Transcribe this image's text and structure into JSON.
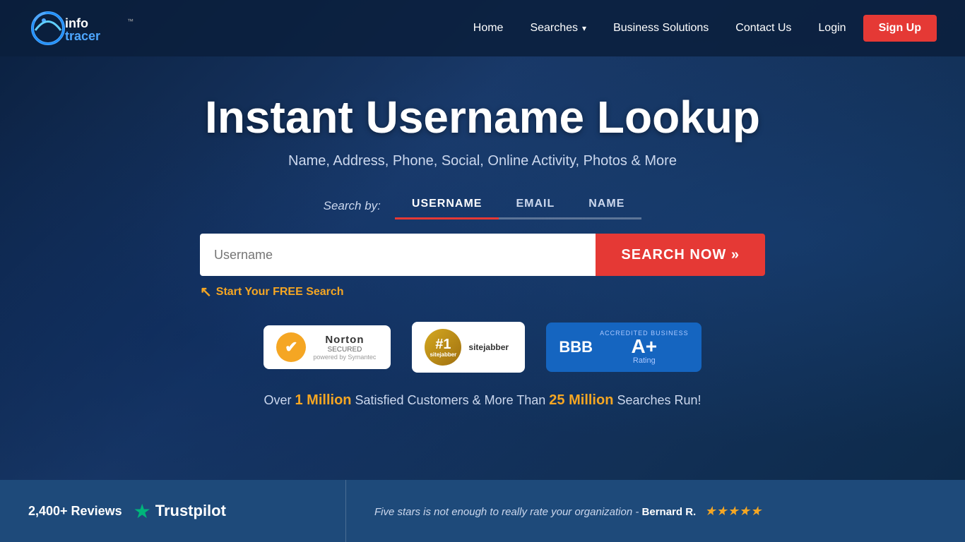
{
  "navbar": {
    "logo_text": "info tracer",
    "links": [
      {
        "id": "home",
        "label": "Home"
      },
      {
        "id": "searches",
        "label": "Searches",
        "has_dropdown": true
      },
      {
        "id": "business",
        "label": "Business Solutions"
      },
      {
        "id": "contact",
        "label": "Contact Us"
      },
      {
        "id": "login",
        "label": "Login"
      }
    ],
    "signup_label": "Sign Up"
  },
  "hero": {
    "title": "Instant Username Lookup",
    "subtitle": "Name, Address, Phone, Social, Online Activity, Photos & More",
    "search_tabs": [
      {
        "id": "username",
        "label": "USERNAME",
        "active": true
      },
      {
        "id": "email",
        "label": "EMAIL",
        "active": false
      },
      {
        "id": "name",
        "label": "NAME",
        "active": false
      }
    ],
    "search_by_label": "Search by:",
    "search_placeholder": "Username",
    "search_button_label": "SEARCH NOW »",
    "free_search_text": "Start Your FREE Search",
    "badges": {
      "norton": {
        "check": "✔",
        "main": "Norton",
        "secured": "SECURED",
        "symantec": "powered by Symantec"
      },
      "sitejabber": {
        "number": "#1",
        "brand": "sitejabber",
        "sub": ""
      },
      "bbb": {
        "logo": "BBB",
        "accredited": "ACCREDITED BUSINESS",
        "rating": "A+",
        "rating_label": "Rating"
      }
    },
    "stats_pre": "Over ",
    "stats_1m": "1 Million",
    "stats_mid": " Satisfied Customers & More Than ",
    "stats_25m": "25 Million",
    "stats_post": " Searches Run!"
  },
  "review_bar": {
    "count": "2,400+ Reviews",
    "trustpilot_label": "Trustpilot",
    "quote": "Five stars is not enough to really rate your organization - ",
    "author": "Bernard R.",
    "stars": "★★★★★"
  },
  "colors": {
    "red": "#e53935",
    "navy": "#1e4a7a",
    "gold": "#f5a623",
    "green": "#00b67a"
  }
}
